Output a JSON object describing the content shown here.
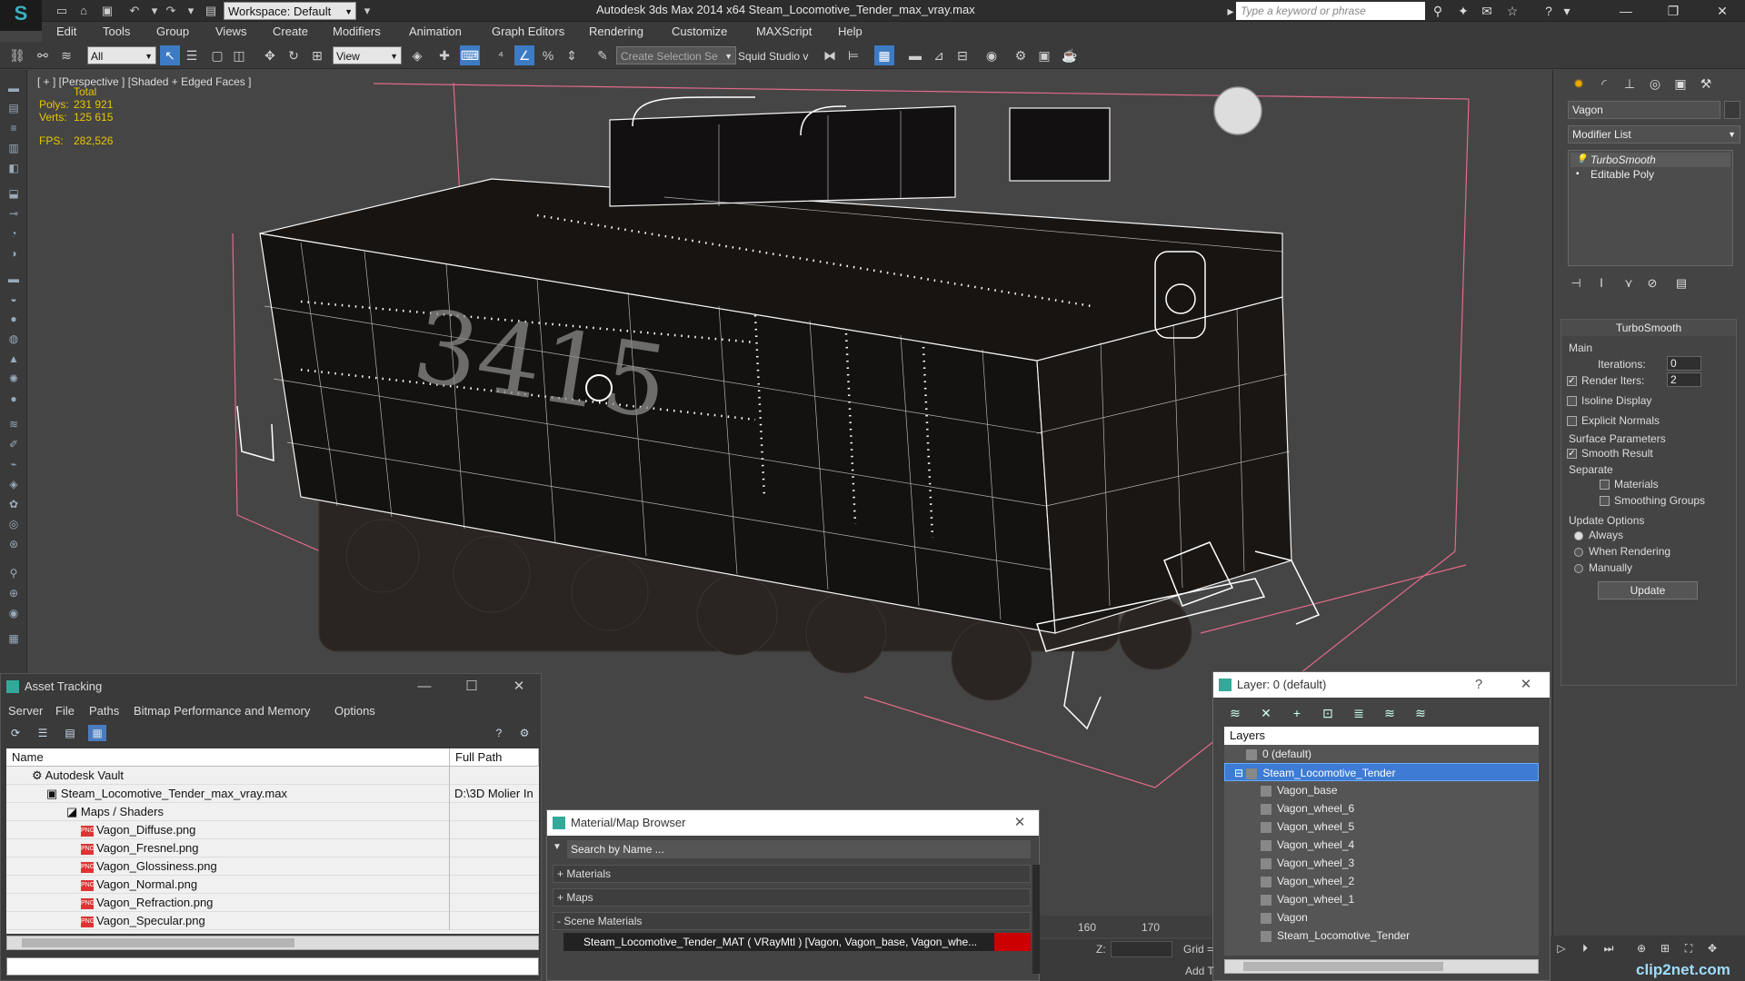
{
  "titlebar": {
    "app_logo": "S",
    "workspace": "Workspace: Default",
    "title": "Autodesk 3ds Max  2014 x64     Steam_Locomotive_Tender_max_vray.max",
    "search_placeholder": "Type a keyword or phrase"
  },
  "menu": [
    "Edit",
    "Tools",
    "Group",
    "Views",
    "Create",
    "Modifiers",
    "Animation",
    "Graph Editors",
    "Rendering",
    "Customize",
    "MAXScript",
    "Help"
  ],
  "toolbar": {
    "filter": "All",
    "refcoord": "View",
    "selection_set_placeholder": "Create Selection Se",
    "studio": "Squid Studio v"
  },
  "viewport": {
    "label": "[ + ] [Perspective ] [Shaded + Edged Faces ]",
    "stats": {
      "total_label": "Total",
      "polys_label": "Polys:",
      "polys": "231 921",
      "verts_label": "Verts:",
      "verts": "125 615",
      "fps_label": "FPS:",
      "fps": "282,526"
    },
    "model_number": "3415"
  },
  "command_panel": {
    "object_name": "Vagon",
    "modifier_list": "Modifier List",
    "stack": [
      "TurboSmooth",
      "Editable Poly"
    ],
    "turbosmooth": {
      "title": "TurboSmooth",
      "main": "Main",
      "iterations_label": "Iterations:",
      "iterations": "0",
      "render_iters_label": "Render Iters:",
      "render_iters": "2",
      "isoline": "Isoline Display",
      "explicit_normals": "Explicit Normals",
      "surface_params": "Surface Parameters",
      "smooth_result": "Smooth Result",
      "separate": "Separate",
      "materials": "Materials",
      "smoothing_groups": "Smoothing Groups",
      "update_options": "Update Options",
      "always": "Always",
      "when_rendering": "When Rendering",
      "manually": "Manually",
      "update_button": "Update"
    }
  },
  "asset_tracking": {
    "title": "Asset Tracking",
    "menu": [
      "Server",
      "File",
      "Paths",
      "Bitmap Performance and Memory",
      "Options"
    ],
    "columns": [
      "Name",
      "Full Path"
    ],
    "rows": [
      {
        "name": "Autodesk Vault",
        "path": ""
      },
      {
        "name": "Steam_Locomotive_Tender_max_vray.max",
        "path": "D:\\3D Molier In"
      },
      {
        "name": "Maps / Shaders",
        "path": ""
      },
      {
        "name": "Vagon_Diffuse.png",
        "path": ""
      },
      {
        "name": "Vagon_Fresnel.png",
        "path": ""
      },
      {
        "name": "Vagon_Glossiness.png",
        "path": ""
      },
      {
        "name": "Vagon_Normal.png",
        "path": ""
      },
      {
        "name": "Vagon_Refraction.png",
        "path": ""
      },
      {
        "name": "Vagon_Specular.png",
        "path": ""
      }
    ],
    "png_badge": "PNG"
  },
  "material_browser": {
    "title": "Material/Map Browser",
    "search_placeholder": "Search by Name ...",
    "sections": [
      "+ Materials",
      "+ Maps",
      "- Scene Materials"
    ],
    "item": "Steam_Locomotive_Tender_MAT  ( VRayMtl ) [Vagon, Vagon_base, Vagon_whe..."
  },
  "layer_window": {
    "title": "Layer: 0 (default)",
    "help": "?",
    "header": "Layers",
    "rows": [
      "0 (default)",
      "Steam_Locomotive_Tender",
      "Vagon_base",
      "Vagon_wheel_6",
      "Vagon_wheel_5",
      "Vagon_wheel_4",
      "Vagon_wheel_3",
      "Vagon_wheel_2",
      "Vagon_wheel_1",
      "Vagon",
      "Steam_Locomotive_Tender"
    ]
  },
  "timeline": {
    "ticks": [
      "160",
      "170"
    ]
  },
  "status": {
    "z_label": "Z:",
    "grid_label": "Grid =",
    "add_label": "Add T"
  },
  "watermark": "clip2net.com",
  "colors": {
    "accent": "#3d7bc4",
    "stats": "#e7c600",
    "selection_box": "#e26a8a"
  }
}
